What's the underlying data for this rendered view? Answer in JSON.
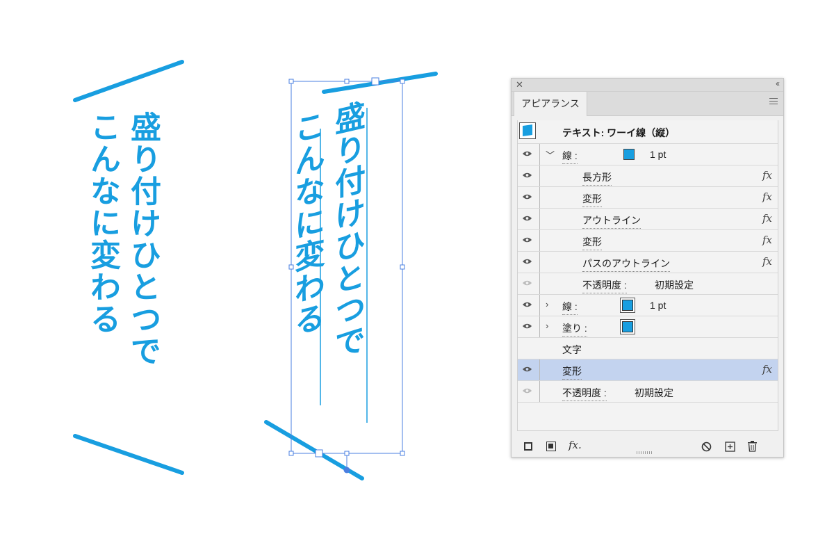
{
  "artwork": {
    "text_lines": [
      "盛り付けひとつで",
      "こんなに変わる"
    ],
    "color": "#189ee0"
  },
  "panel": {
    "tab_label": "アピアランス",
    "header_title": "テキスト: ワーイ線（縦）",
    "rows": [
      {
        "label": "線 :",
        "value": "1 pt",
        "expanded": "﹀"
      },
      {
        "label": "長方形",
        "fx": "fx"
      },
      {
        "label": "変形",
        "fx": "fx"
      },
      {
        "label": "アウトライン",
        "fx": "fx"
      },
      {
        "label": "変形",
        "fx": "fx"
      },
      {
        "label": "パスのアウトライン",
        "fx": "fx"
      },
      {
        "label": "不透明度 :",
        "value": "初期設定"
      },
      {
        "label": "線 :",
        "value": "1 pt",
        "expanded": "›"
      },
      {
        "label": "塗り :",
        "expanded": "›"
      },
      {
        "label": "文字"
      },
      {
        "label": "変形",
        "fx": "fx"
      },
      {
        "label": "不透明度 :",
        "value": "初期設定"
      }
    ],
    "bottom_fx": "fx."
  }
}
